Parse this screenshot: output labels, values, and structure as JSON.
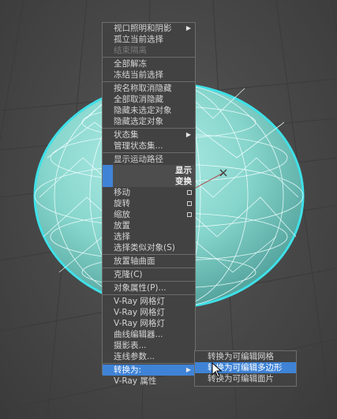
{
  "quad_menu": {
    "group1": [
      {
        "label": "视口照明和阴影",
        "disabled": false,
        "submenu": true
      },
      {
        "label": "孤立当前选择",
        "disabled": false
      },
      {
        "label": "结束隔离",
        "disabled": true
      }
    ],
    "group2": [
      {
        "label": "全部解冻",
        "disabled": false
      },
      {
        "label": "冻结当前选择",
        "disabled": false
      }
    ],
    "group3": [
      {
        "label": "按名称取消隐藏",
        "disabled": false
      },
      {
        "label": "全部取消隐藏",
        "disabled": false
      },
      {
        "label": "隐藏未选定对象",
        "disabled": false
      },
      {
        "label": "隐藏选定对象",
        "disabled": false
      }
    ],
    "group4": [
      {
        "label": "状态集",
        "disabled": false,
        "submenu": true
      },
      {
        "label": "管理状态集...",
        "disabled": false
      }
    ],
    "group5": [
      {
        "label": "显示运动路径",
        "disabled": false
      }
    ],
    "header_display": "显示",
    "header_transform": "变换",
    "group6": [
      {
        "label": "移动",
        "disabled": false,
        "option": true
      },
      {
        "label": "旋转",
        "disabled": false,
        "option": true
      },
      {
        "label": "缩放",
        "disabled": false,
        "option": true
      },
      {
        "label": "放置",
        "disabled": false
      },
      {
        "label": "选择",
        "disabled": false
      },
      {
        "label": "选择类似对象(S)",
        "disabled": false
      }
    ],
    "group7": [
      {
        "label": "放置轴曲面",
        "disabled": false
      }
    ],
    "group8": [
      {
        "label": "克隆(C)",
        "disabled": false
      }
    ],
    "group9": [
      {
        "label": "对象属性(P)...",
        "disabled": false
      }
    ],
    "group10": [
      {
        "label": "V-Ray 网格灯",
        "disabled": false
      },
      {
        "label": "V-Ray 网格灯",
        "disabled": false
      },
      {
        "label": "V-Ray 网格灯",
        "disabled": false
      },
      {
        "label": "曲线编辑器...",
        "disabled": false
      },
      {
        "label": "摄影表...",
        "disabled": false
      },
      {
        "label": "连线参数...",
        "disabled": false
      }
    ],
    "group11": [
      {
        "label": "转换为:",
        "disabled": false,
        "submenu": true,
        "highlight": true
      },
      {
        "label": "V-Ray 属性",
        "disabled": false
      }
    ]
  },
  "convert_submenu": [
    {
      "label": "转换为可编辑网格",
      "highlight": false
    },
    {
      "label": "转换为可编辑多边形",
      "highlight": true
    },
    {
      "label": "转换为可编辑面片",
      "highlight": false
    }
  ],
  "colors": {
    "highlight": "#3f83d6",
    "sphere_fill": "#8fdbd3",
    "sphere_outline": "#3fe0e8",
    "menu_bg": "#424242"
  },
  "icons": {
    "submenu_arrow": "▶",
    "cursor": "arrow-cursor-icon"
  }
}
